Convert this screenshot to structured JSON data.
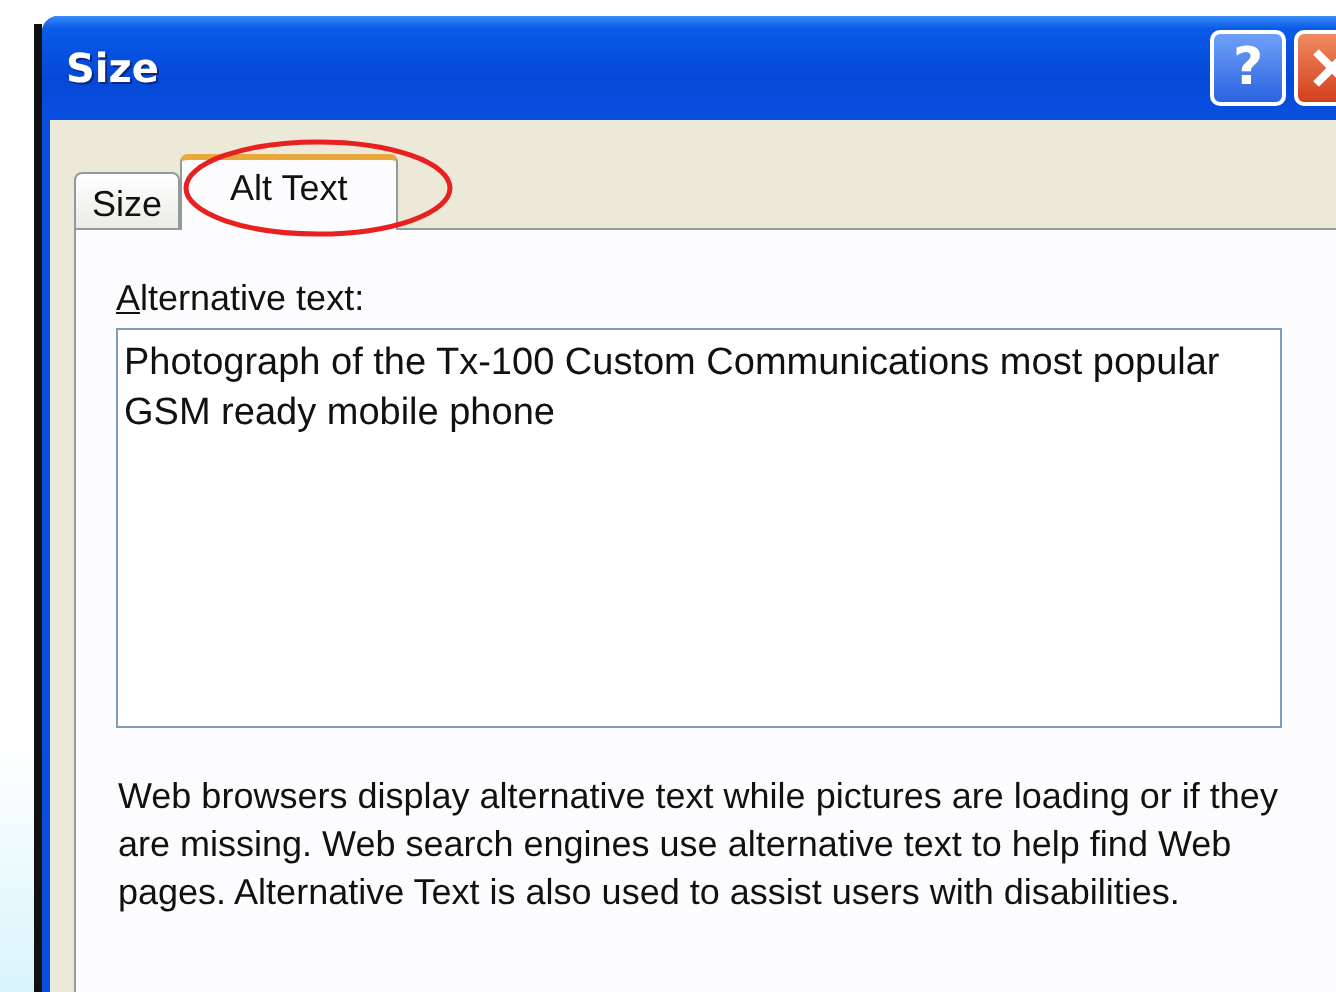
{
  "window": {
    "title": "Size",
    "help_button": "?"
  },
  "tabs": [
    {
      "label": "Size",
      "selected": false
    },
    {
      "label": "Alt Text",
      "selected": true
    }
  ],
  "annotation": {
    "kind": "ellipse"
  },
  "alt_text": {
    "label": "Alternative text:",
    "value": "Photograph of the Tx-100 Custom Communications most popular GSM ready mobile phone"
  },
  "help_text": "Web browsers display alternative text while pictures are loading or if they are missing.  Web search engines use alternative text to help find Web pages.  Alternative Text is also used to assist users with disabilities."
}
